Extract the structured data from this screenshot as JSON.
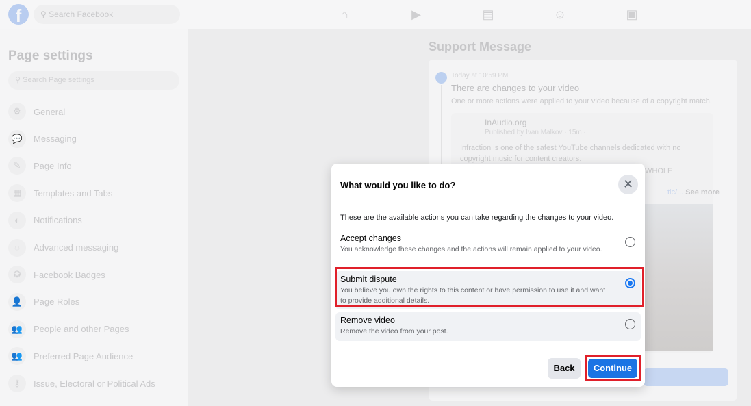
{
  "topbar": {
    "search_placeholder": "Search Facebook",
    "nav_icons": [
      "home-icon",
      "watch-icon",
      "marketplace-icon",
      "groups-icon",
      "gaming-icon"
    ]
  },
  "sidebar": {
    "title": "Page settings",
    "search_placeholder": "Search Page settings",
    "items": [
      {
        "label": "General",
        "icon": "⚙"
      },
      {
        "label": "Messaging",
        "icon": "💬"
      },
      {
        "label": "Page Info",
        "icon": "✎"
      },
      {
        "label": "Templates and Tabs",
        "icon": "▦"
      },
      {
        "label": "Notifications",
        "icon": "◐"
      },
      {
        "label": "Advanced messaging",
        "icon": "◌"
      },
      {
        "label": "Facebook Badges",
        "icon": "✪"
      },
      {
        "label": "Page Roles",
        "icon": "👤"
      },
      {
        "label": "People and other Pages",
        "icon": "👥"
      },
      {
        "label": "Preferred Page Audience",
        "icon": "👥"
      },
      {
        "label": "Issue, Electoral or Political Ads",
        "icon": "⚷"
      }
    ]
  },
  "main": {
    "title": "Support Message",
    "message": {
      "time": "Today at 10:59 PM",
      "title": "There are changes to your video",
      "body": "One or more actions were applied to your video because of a copyright match.",
      "post": {
        "page": "InAudio.org",
        "meta": "Published by Ivan Malkov · 15m ·",
        "text": "Infraction is one of the safest YouTube channels dedicated with no copyright music for content creators.",
        "partial1": "WHOLE",
        "partial2": "tic/...",
        "see_more": "See more"
      }
    }
  },
  "modal": {
    "title": "What would you like to do?",
    "intro": "These are the available actions you can take regarding the changes to your video.",
    "options": [
      {
        "title": "Accept changes",
        "desc": "You acknowledge these changes and the actions will remain applied to your video.",
        "selected": false
      },
      {
        "title": "Submit dispute",
        "desc": "You believe you own the rights to this content or have permission to use it and want to provide additional details.",
        "selected": true
      },
      {
        "title": "Remove video",
        "desc": "Remove the video from your post.",
        "selected": false
      }
    ],
    "back_label": "Back",
    "continue_label": "Continue"
  },
  "colors": {
    "accent": "#1b74e4",
    "highlight": "#e0202a"
  }
}
